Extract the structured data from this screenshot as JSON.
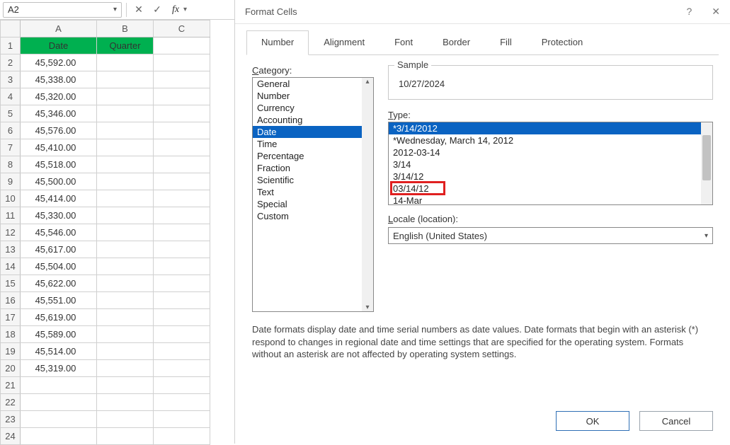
{
  "formula_bar": {
    "name_box": "A2",
    "fx_label": "fx"
  },
  "grid": {
    "columns": [
      "A",
      "B",
      "C"
    ],
    "header_row": {
      "A": "Date",
      "B": "Quarter"
    },
    "row_count": 24,
    "data": [
      "45,592.00",
      "45,338.00",
      "45,320.00",
      "45,346.00",
      "45,576.00",
      "45,410.00",
      "45,518.00",
      "45,500.00",
      "45,414.00",
      "45,330.00",
      "45,546.00",
      "45,617.00",
      "45,504.00",
      "45,622.00",
      "45,551.00",
      "45,619.00",
      "45,589.00",
      "45,514.00",
      "45,319.00"
    ]
  },
  "dialog": {
    "title": "Format Cells",
    "tabs": [
      "Number",
      "Alignment",
      "Font",
      "Border",
      "Fill",
      "Protection"
    ],
    "active_tab": 0,
    "category_label": "Category:",
    "categories": [
      "General",
      "Number",
      "Currency",
      "Accounting",
      "Date",
      "Time",
      "Percentage",
      "Fraction",
      "Scientific",
      "Text",
      "Special",
      "Custom"
    ],
    "selected_category": "Date",
    "sample_label": "Sample",
    "sample_value": "10/27/2024",
    "type_label": "Type:",
    "types": [
      "*3/14/2012",
      "*Wednesday, March 14, 2012",
      "2012-03-14",
      "3/14",
      "3/14/12",
      "03/14/12",
      "14-Mar"
    ],
    "selected_type_index": 0,
    "highlighted_type_index": 5,
    "locale_label": "Locale (location):",
    "locale_value": "English (United States)",
    "description": "Date formats display date and time serial numbers as date values.  Date formats that begin with an asterisk (*) respond to changes in regional date and time settings that are specified for the operating system. Formats without an asterisk are not affected by operating system settings.",
    "ok_label": "OK",
    "cancel_label": "Cancel"
  }
}
